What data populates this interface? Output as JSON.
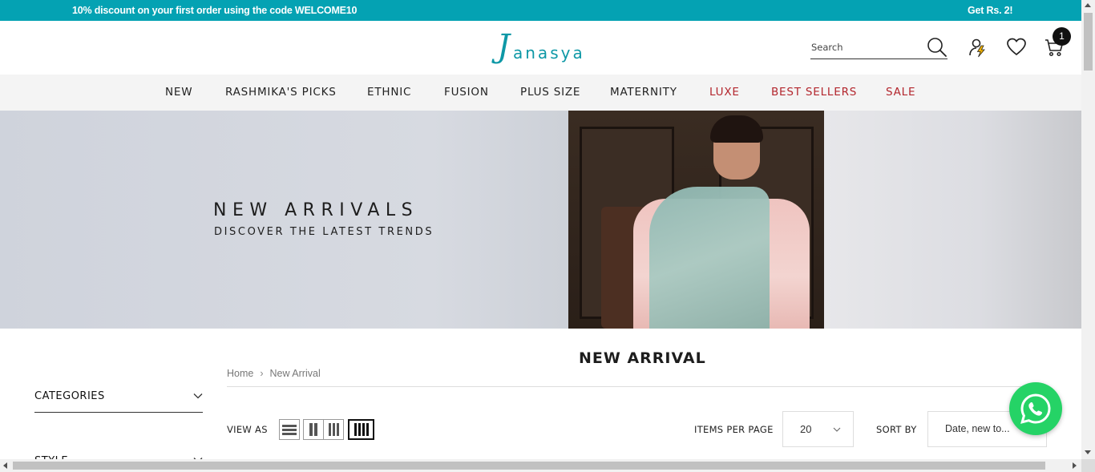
{
  "announcement": {
    "left_text": "10% discount on your first order using the code WELCOME10",
    "right_text": "Get Rs. 2!"
  },
  "header": {
    "logo_initial": "J",
    "logo_rest": "anasya",
    "search": {
      "placeholder": "Search"
    },
    "cart_count": "1",
    "icons": [
      "search-icon",
      "flash-user-icon",
      "heart-icon",
      "cart-icon"
    ]
  },
  "nav": {
    "items": [
      {
        "label": "NEW"
      },
      {
        "label": "RASHMIKA'S PICKS"
      },
      {
        "label": "ETHNIC"
      },
      {
        "label": "FUSION"
      },
      {
        "label": "PLUS SIZE"
      },
      {
        "label": "MATERNITY"
      },
      {
        "label": "LUXE",
        "highlight": true
      },
      {
        "label": "BEST SELLERS",
        "highlight": true
      },
      {
        "label": "SALE",
        "highlight": true
      }
    ]
  },
  "banner": {
    "title": "NEW ARRIVALS",
    "subtitle": "DISCOVER THE LATEST TRENDS"
  },
  "collection": {
    "title": "NEW ARRIVAL",
    "breadcrumb": [
      "Home",
      "New Arrival"
    ]
  },
  "sidebar": {
    "sections": [
      {
        "label": "CATEGORIES"
      },
      {
        "label": "STYLE"
      }
    ]
  },
  "toolbar": {
    "view_as_label": "VIEW AS",
    "view_modes": [
      "list",
      "2-columns",
      "3-columns",
      "4-columns"
    ],
    "active_view": "4-columns",
    "items_per_page_label": "ITEMS PER PAGE",
    "items_per_page_value": "20",
    "sort_by_label": "SORT BY",
    "sort_by_value": "Date, new to..."
  },
  "colors": {
    "announcement_bg": "#04a2b3",
    "brand": "#0e98a6",
    "nav_highlight": "#b3262d",
    "whatsapp": "#25d366"
  }
}
